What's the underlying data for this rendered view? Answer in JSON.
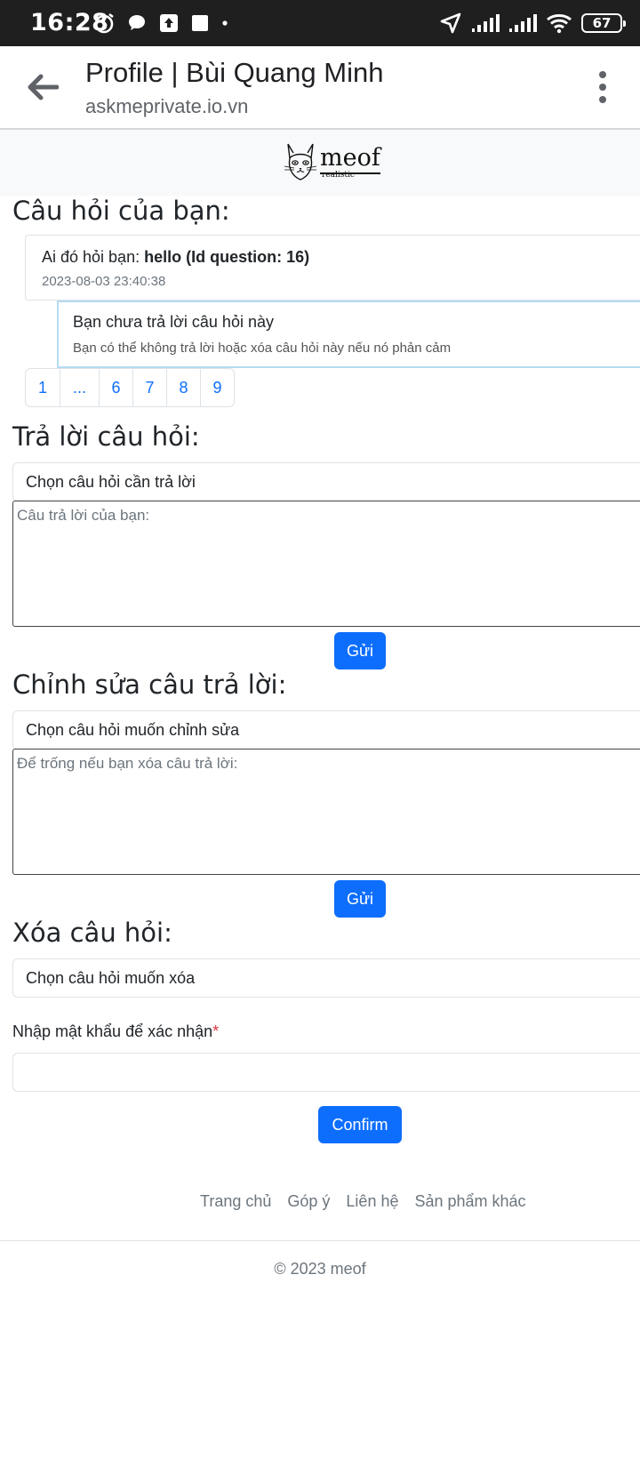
{
  "status_bar": {
    "time": "16:28",
    "battery": "67",
    "icons": [
      "alarm-icon",
      "chat-bubble-icon",
      "upload-icon",
      "square-notification-icon",
      "dot-icon",
      "location-arrow-icon",
      "signal-icon",
      "signal-icon",
      "wifi-icon",
      "battery-icon"
    ]
  },
  "browser": {
    "title": "Profile | Bùi Quang Minh",
    "url": "askmeprivate.io.vn"
  },
  "site": {
    "logo_text": "meof",
    "logo_tagline": "realistic"
  },
  "questions_section": {
    "heading": "Câu hỏi của bạn:",
    "question": {
      "prefix": "Ai đó hỏi bạn: ",
      "text": "hello (Id question: 16)",
      "date": "2023-08-03 23:40:38"
    },
    "answer": {
      "title": "Bạn chưa trả lời câu hỏi này",
      "note": "Bạn có thể không trả lời hoặc xóa câu hỏi này nếu nó phản cảm"
    },
    "pagination": [
      "1",
      "...",
      "6",
      "7",
      "8",
      "9"
    ]
  },
  "answer_section": {
    "heading": "Trả lời câu hỏi:",
    "select_value": "Chọn câu hỏi cần trả lời",
    "textarea_placeholder": "Câu trả lời của bạn:",
    "submit_label": "Gửi"
  },
  "edit_section": {
    "heading": "Chỉnh sửa câu trả lời:",
    "select_value": "Chọn câu hỏi muốn chỉnh sửa",
    "textarea_placeholder": "Để trống nếu bạn xóa câu trả lời:",
    "submit_label": "Gửi"
  },
  "delete_section": {
    "heading": "Xóa câu hỏi:",
    "select_value": "Chọn câu hỏi muốn xóa",
    "password_label": "Nhập mật khẩu để xác nhận",
    "required_mark": "*",
    "confirm_label": "Confirm"
  },
  "footer": {
    "links": [
      "Trang chủ",
      "Góp ý",
      "Liên hệ",
      "Sản phẩm khác"
    ],
    "copyright": "© 2023 meof"
  },
  "colors": {
    "primary": "#0d6efd",
    "status_bar": "#1f1f1f",
    "answer_border": "#b6dbf0",
    "required": "#dc3545"
  }
}
